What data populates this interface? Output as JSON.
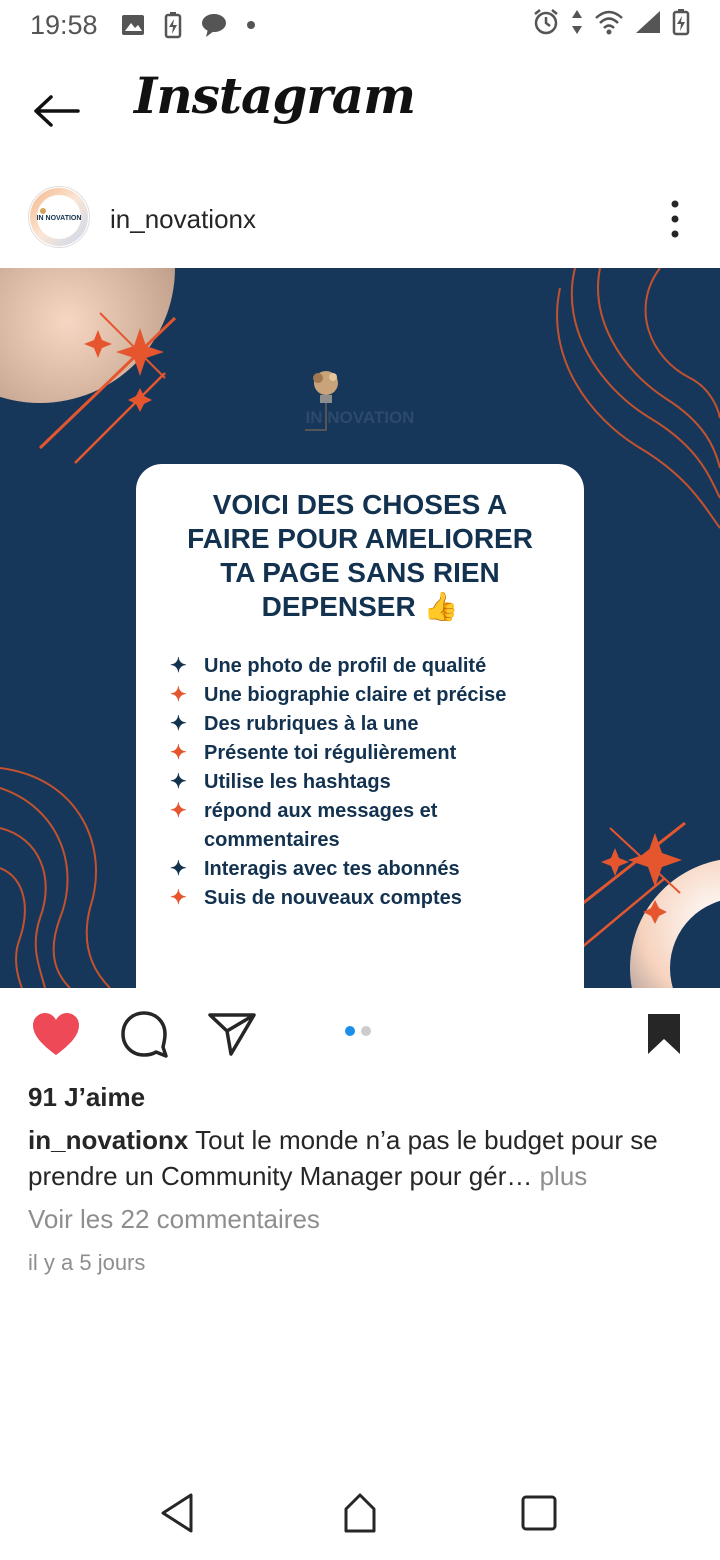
{
  "status_bar": {
    "time": "19:58",
    "icons_left": [
      "image-icon",
      "battery-saver-icon",
      "chat-bubble-icon",
      "dot-icon"
    ],
    "icons_right": [
      "alarm-icon",
      "data-arrows-icon",
      "wifi-icon",
      "signal-icon",
      "battery-icon"
    ]
  },
  "header": {
    "title": "Instagram",
    "back_icon": "back-arrow-icon"
  },
  "post": {
    "username": "in_novationx",
    "avatar_text": "IN NOVATION",
    "image": {
      "brand": "IN NOVATION",
      "title": "VOICI DES CHOSES A\nFAIRE POUR AMELIORER\nTA PAGE SANS RIEN\nDEPENSER 👍",
      "bullets": [
        "Une photo de profil de qualité",
        "Une biographie claire et précise",
        "Des rubriques à la une",
        "Présente toi régulièrement",
        "Utilise les hashtags",
        "répond aux messages et commentaires",
        "Interagis avec tes abonnés",
        "Suis de nouveaux comptes"
      ],
      "colors": {
        "background": "#16375a",
        "accent_orange": "#e5562f",
        "text_navy": "#13324f"
      }
    },
    "carousel": {
      "total": 2,
      "active": 1
    },
    "likes": "91 J’aime",
    "caption_user": "in_novationx",
    "caption_text": " Tout le monde n’a pas le budget pour se prendre un Community  Manager pour gér…",
    "caption_more": " plus",
    "comments_link": "Voir les 22 commentaires",
    "timestamp": "il y a 5 jours",
    "liked": true,
    "saved": true,
    "like_color": "#ed4956"
  },
  "nav": {
    "icons": [
      "back-triangle-icon",
      "home-icon",
      "recents-icon"
    ]
  }
}
